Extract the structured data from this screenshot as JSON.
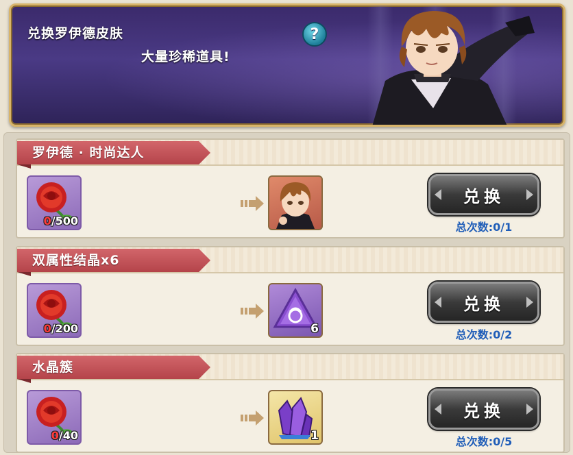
{
  "banner": {
    "title": "兑换罗伊德皮肤",
    "subtitle": "大量珍稀道具!",
    "help_label": "?"
  },
  "exchanges": [
    {
      "name": "罗伊德 · 时尚达人",
      "cost_item": "rose-icon",
      "cost_have": "0",
      "cost_need": "/500",
      "reward_item": "lloyd-portrait-icon",
      "reward_count": "",
      "button_label": "兑换",
      "total_label": "总次数:0/1"
    },
    {
      "name": "双属性结晶x6",
      "cost_item": "rose-icon",
      "cost_have": "0",
      "cost_need": "/200",
      "reward_item": "dual-crystal-icon",
      "reward_count": "6",
      "button_label": "兑换",
      "total_label": "总次数:0/2"
    },
    {
      "name": "水晶簇",
      "cost_item": "rose-icon",
      "cost_have": "0",
      "cost_need": "/40",
      "reward_item": "crystal-cluster-icon",
      "reward_count": "1",
      "button_label": "兑换",
      "total_label": "总次数:0/5"
    }
  ]
}
